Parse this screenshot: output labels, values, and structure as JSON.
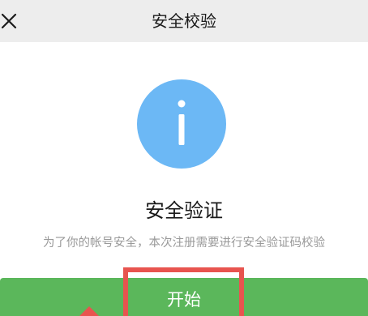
{
  "nav": {
    "title": "安全校验",
    "close_icon": "close-icon"
  },
  "content": {
    "icon": "info-icon",
    "heading": "安全验证",
    "description": "为了你的帐号安全，本次注册需要进行安全验证码校验"
  },
  "actions": {
    "start_label": "开始"
  },
  "colors": {
    "nav_bg": "#ededed",
    "info_icon": "#6cb8f5",
    "button_bg": "#5bb75b",
    "highlight": "#e8544f"
  }
}
